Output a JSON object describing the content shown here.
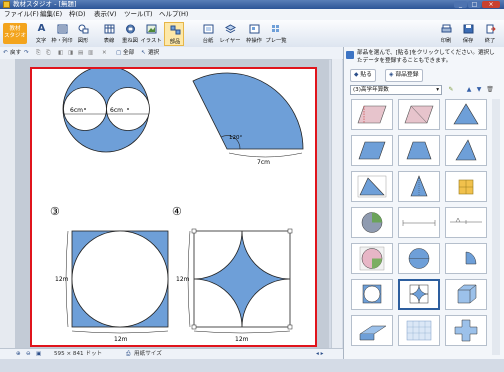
{
  "window": {
    "title": "教材スタジオ - [無題]",
    "minimize": "_",
    "maximize": "□",
    "close": "×"
  },
  "menu": [
    "ファイル(F)",
    "編集(E)",
    "枠(D)",
    "表示(V)",
    "ツール(T)",
    "ヘルプ(H)"
  ],
  "brand": {
    "line1": "教材",
    "line2": "スタジオ"
  },
  "ribbon": [
    "文字",
    "枠・列印",
    "図形",
    "表線",
    "重ね図",
    "イラスト",
    "部品",
    "台紙",
    "レイヤー",
    "枠操作",
    "プレ一覧"
  ],
  "ribbon_right": [
    "印刷",
    "保存",
    "終了"
  ],
  "toolbar": {
    "undo": "戻す",
    "select_all": "全部",
    "select": "選択"
  },
  "panel": {
    "info": "部品を選んで、[貼る]をクリックしてください。選択したデータを登録することもできます。",
    "paste": "貼る",
    "register": "部品登録",
    "category": "(3)高学年算数"
  },
  "page": {
    "circle3": "③",
    "circle4": "④",
    "dim_6cm_a": "6cm",
    "dim_6cm_b": "6cm",
    "angle": "120°",
    "dim_7cm": "7cm",
    "dim_12m_a": "12m",
    "dim_12m_b": "12m",
    "dim_12m_c": "12m",
    "dim_12m_d": "12m"
  },
  "status": {
    "size": "595 × 841 ドット",
    "fit": "用紙サイズ"
  },
  "colors": {
    "accent": "#e0141c",
    "fill": "#6e9fd8",
    "ribbon_brand": "#f3a41d"
  }
}
